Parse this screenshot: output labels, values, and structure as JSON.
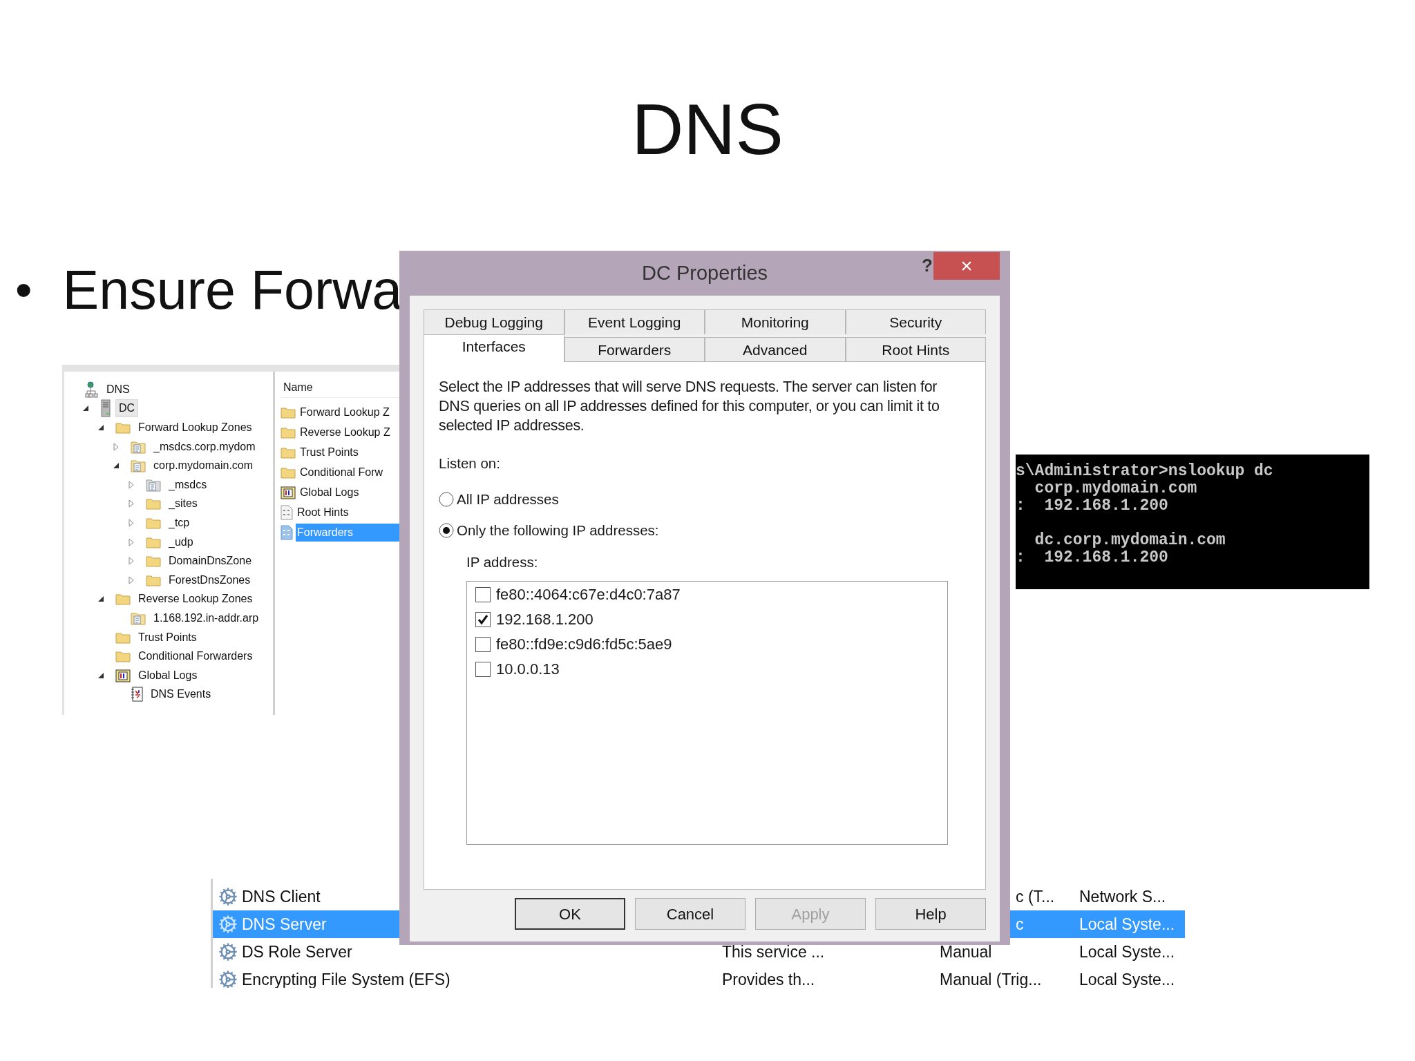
{
  "slide": {
    "title": "DNS",
    "bullets": [
      {
        "marker": "•",
        "text": "Ensure Forwa"
      }
    ]
  },
  "dns_manager": {
    "tree": [
      {
        "label": "DNS",
        "kind": "dns",
        "selected": false,
        "children": [
          {
            "label": "DC",
            "kind": "server",
            "expanded": true,
            "selected": true,
            "children": [
              {
                "label": "Forward Lookup Zones",
                "kind": "folder",
                "expanded": true,
                "selected": false,
                "children": [
                  {
                    "label": "_msdcs.corp.mydom",
                    "kind": "zone",
                    "expanded": false,
                    "selected": false
                  },
                  {
                    "label": "corp.mydomain.com",
                    "kind": "zone",
                    "expanded": true,
                    "selected": false,
                    "children": [
                      {
                        "label": "_msdcs",
                        "kind": "zone_gray",
                        "expanded": false,
                        "selected": false
                      },
                      {
                        "label": "_sites",
                        "kind": "folder",
                        "expanded": false,
                        "selected": false
                      },
                      {
                        "label": "_tcp",
                        "kind": "folder",
                        "expanded": false,
                        "selected": false
                      },
                      {
                        "label": "_udp",
                        "kind": "folder",
                        "expanded": false,
                        "selected": false
                      },
                      {
                        "label": "DomainDnsZone",
                        "kind": "folder",
                        "expanded": false,
                        "selected": false
                      },
                      {
                        "label": "ForestDnsZones",
                        "kind": "folder",
                        "expanded": false,
                        "selected": false
                      }
                    ]
                  }
                ]
              },
              {
                "label": "Reverse Lookup Zones",
                "kind": "folder",
                "expanded": true,
                "selected": false,
                "children": [
                  {
                    "label": "1.168.192.in-addr.arp",
                    "kind": "zone",
                    "selected": false
                  }
                ]
              },
              {
                "label": "Trust Points",
                "kind": "folder",
                "selected": false
              },
              {
                "label": "Conditional Forwarders",
                "kind": "folder",
                "selected": false
              },
              {
                "label": "Global Logs",
                "kind": "logs",
                "expanded": true,
                "selected": false,
                "children": [
                  {
                    "label": "DNS Events",
                    "kind": "events",
                    "selected": false
                  }
                ]
              }
            ]
          }
        ]
      }
    ],
    "list": {
      "column": "Name",
      "items": [
        {
          "label": "Forward Lookup Z",
          "kind": "folder",
          "selected": false
        },
        {
          "label": "Reverse Lookup Z",
          "kind": "folder",
          "selected": false
        },
        {
          "label": "Trust Points",
          "kind": "folder",
          "selected": false
        },
        {
          "label": "Conditional Forw",
          "kind": "folder",
          "selected": false
        },
        {
          "label": "Global Logs",
          "kind": "logs",
          "selected": false
        },
        {
          "label": "Root Hints",
          "kind": "hints",
          "selected": false
        },
        {
          "label": "Forwarders",
          "kind": "hints",
          "selected": true
        }
      ]
    }
  },
  "services": {
    "rows": [
      {
        "name": "DNS Client",
        "selected": false,
        "startup": "c (T...",
        "log_on_as": "Network S..."
      },
      {
        "name": "DNS Server",
        "selected": true,
        "startup": "c",
        "log_on_as": "Local Syste..."
      },
      {
        "name": "DS Role Server",
        "selected": false,
        "description": "This service ...",
        "startup": "Manual",
        "log_on_as": "Local Syste..."
      },
      {
        "name": "Encrypting File System (EFS)",
        "selected": false,
        "description": "Provides th...",
        "startup": "Manual (Trig...",
        "log_on_as": "Local Syste..."
      }
    ]
  },
  "console": {
    "blocks": [
      [
        "s\\Administrator>nslookup dc",
        "  corp.mydomain.com",
        ":  192.168.1.200"
      ],
      [
        "  dc.corp.mydomain.com",
        ":  192.168.1.200"
      ]
    ]
  },
  "dialog": {
    "title": "DC Properties",
    "help": "?",
    "close": "×",
    "tab_rows": [
      [
        {
          "label": "Debug Logging",
          "selected": false
        },
        {
          "label": "Event Logging",
          "selected": false
        },
        {
          "label": "Monitoring",
          "selected": false
        },
        {
          "label": "Security",
          "selected": false
        }
      ],
      [
        {
          "label": "Interfaces",
          "selected": true
        },
        {
          "label": "Forwarders",
          "selected": false
        },
        {
          "label": "Advanced",
          "selected": false
        },
        {
          "label": "Root Hints",
          "selected": false
        }
      ]
    ],
    "description": "Select the IP addresses that will serve DNS requests. The server can listen for DNS queries on all IP addresses defined for this computer, or you can limit it to selected IP addresses.",
    "listen_label": "Listen on:",
    "options": [
      {
        "label": "All IP addresses",
        "selected": false
      },
      {
        "label": "Only the following IP addresses:",
        "selected": true
      }
    ],
    "ip_label": "IP address:",
    "addresses": [
      {
        "label": "fe80::4064:c67e:d4c0:7a87",
        "checked": false
      },
      {
        "label": "192.168.1.200",
        "checked": true
      },
      {
        "label": "fe80::fd9e:c9d6:fd5c:5ae9",
        "checked": false
      },
      {
        "label": "10.0.0.13",
        "checked": false
      }
    ],
    "buttons": [
      {
        "label": "OK",
        "default": true,
        "disabled": false
      },
      {
        "label": "Cancel",
        "default": false,
        "disabled": false
      },
      {
        "label": "Apply",
        "default": false,
        "disabled": true
      },
      {
        "label": "Help",
        "default": false,
        "disabled": false
      }
    ]
  }
}
